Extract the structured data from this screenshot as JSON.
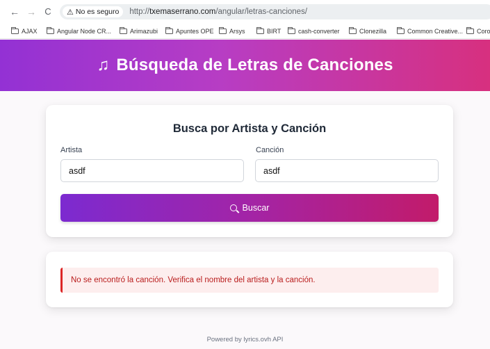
{
  "browser": {
    "security_label": "No es seguro",
    "url_prefix": "http://",
    "url_host": "txemaserrano.com",
    "url_path": "/angular/letras-canciones/",
    "bookmarks": [
      "AJAX",
      "Angular Node CR...",
      "Arimazubi",
      "Apuntes OPE",
      "Arsys",
      "BIRT",
      "cash-converter",
      "Clonezilla",
      "Common Creative...",
      "Coro"
    ]
  },
  "header": {
    "title": "Búsqueda de Letras de Canciones"
  },
  "search": {
    "title": "Busca por Artista y Canción",
    "artist_label": "Artista",
    "artist_value": "asdf",
    "song_label": "Canción",
    "song_value": "asdf",
    "button_label": "Buscar"
  },
  "error": {
    "message": "No se encontró la canción. Verifica el nombre del artista y la canción."
  },
  "footer": {
    "text": "Powered by lyrics.ovh API"
  },
  "colors": {
    "banner_start": "#9331d4",
    "banner_end": "#d7307f",
    "error_text": "#b91c1c",
    "error_bg": "#fdeeee"
  }
}
